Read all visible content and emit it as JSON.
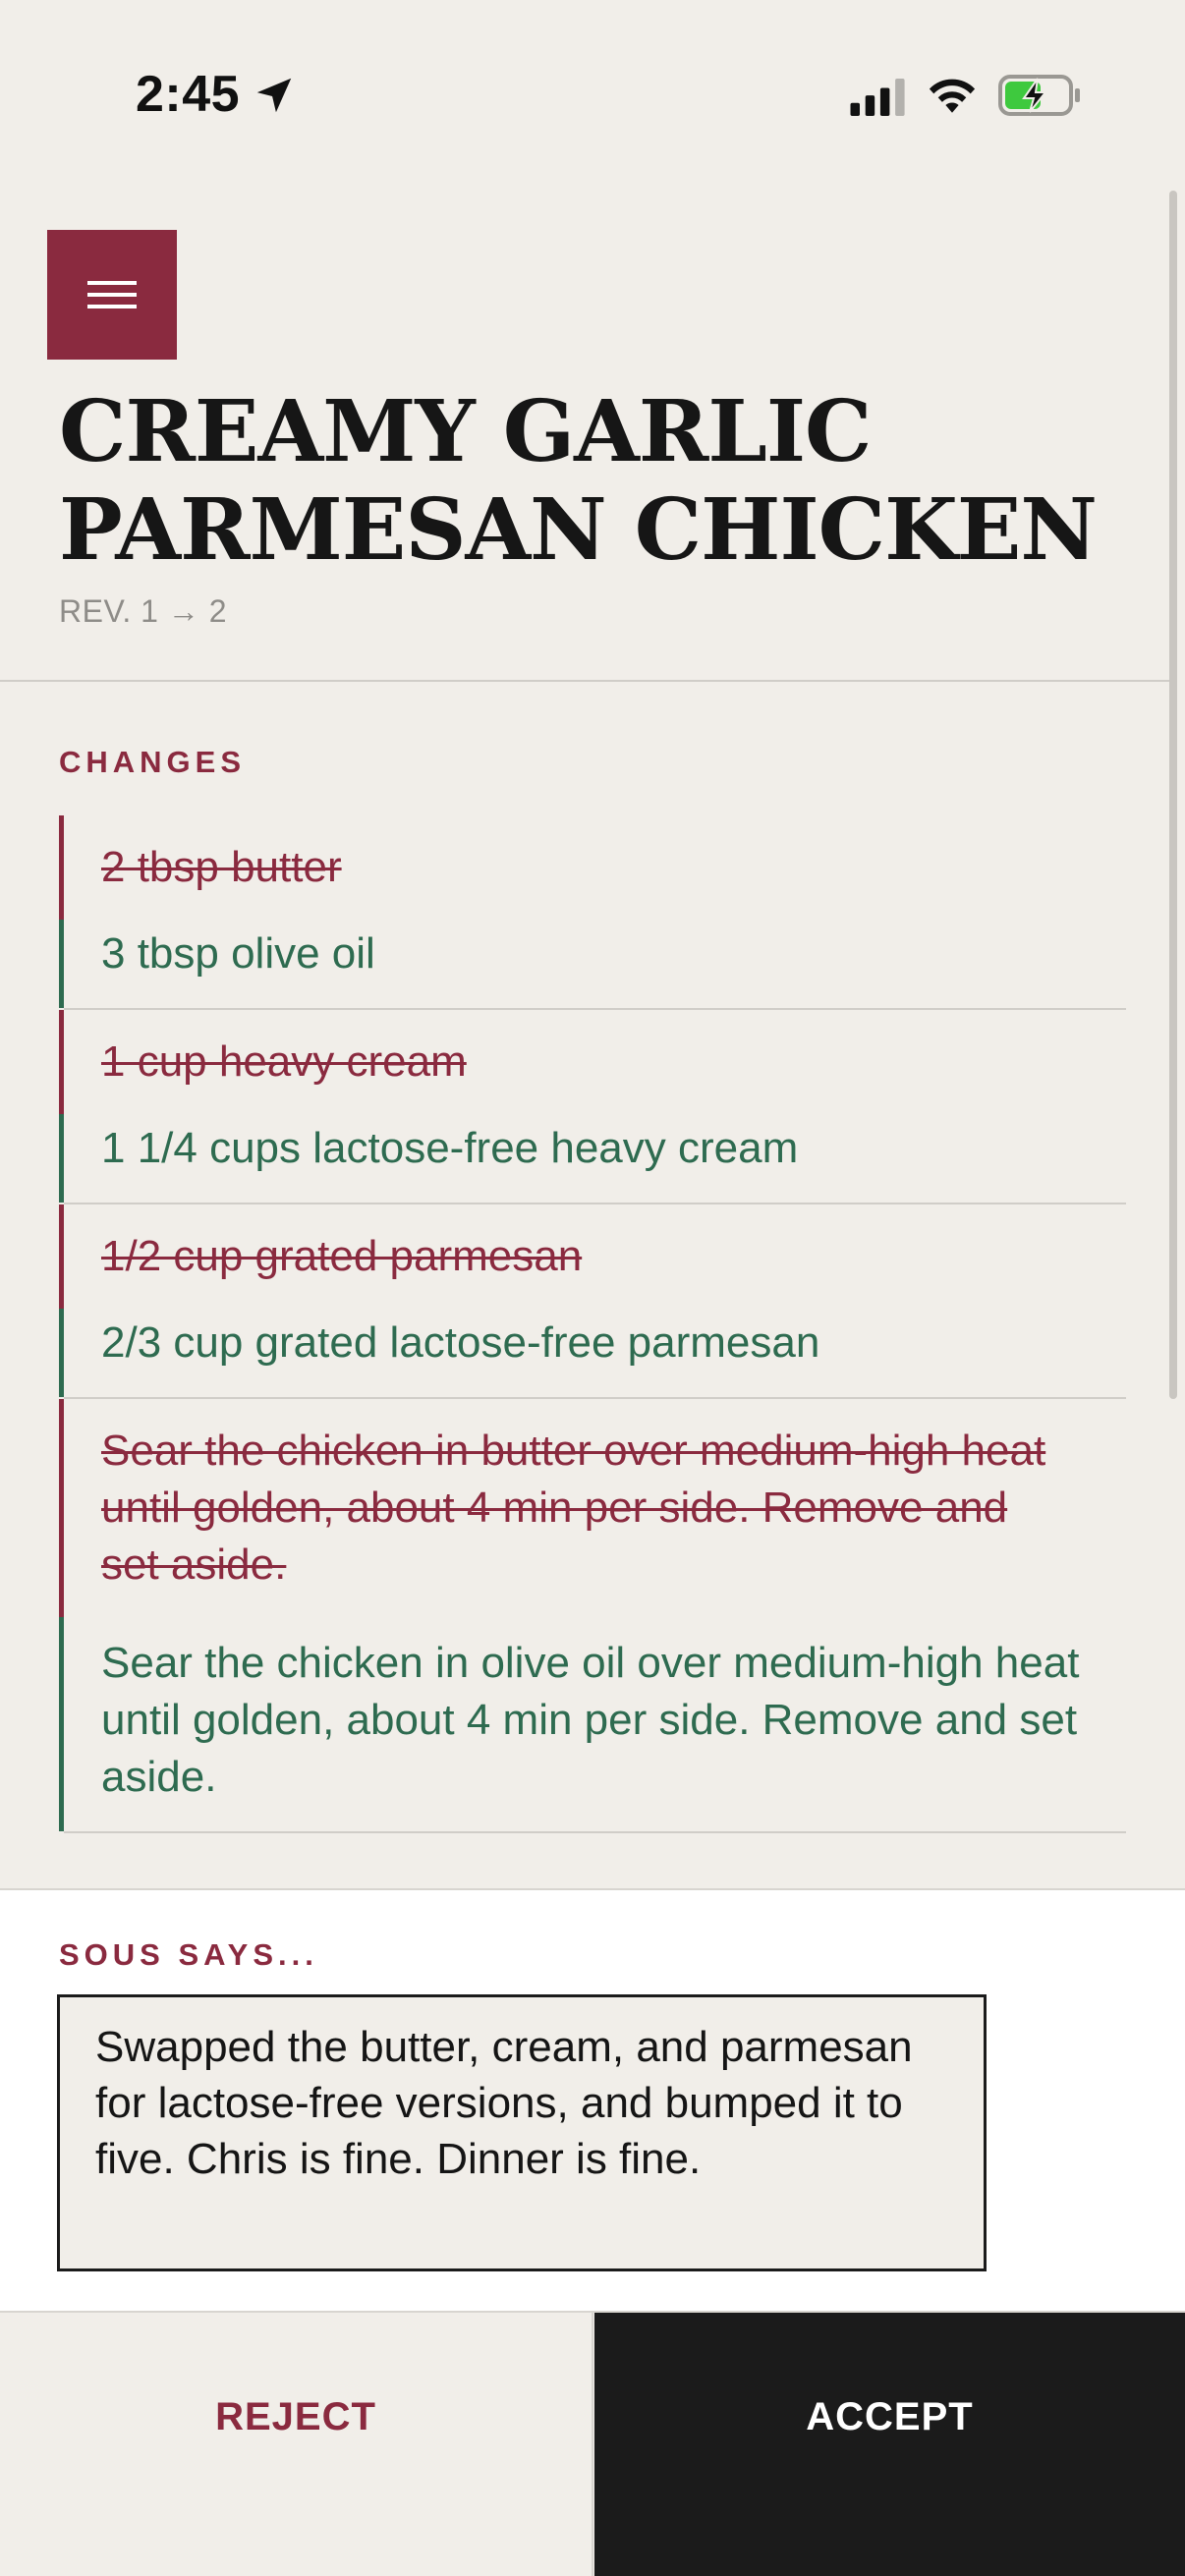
{
  "status_bar": {
    "time": "2:45",
    "location_icon": "location-arrow-icon",
    "signal_icon": "cellular-signal-icon",
    "wifi_icon": "wifi-icon",
    "battery_icon": "battery-charging-icon"
  },
  "header": {
    "menu_icon": "hamburger-menu-icon",
    "title_line1": "CREAMY GARLIC",
    "title_line2": "PARMESAN CHICKEN",
    "revision": "REV. 1 → 2"
  },
  "changes": {
    "label": "CHANGES",
    "items": [
      {
        "removed": "2 tbsp butter",
        "added": "3 tbsp olive oil"
      },
      {
        "removed": "1 cup heavy cream",
        "added": "1 1/4 cups lactose-free heavy cream"
      },
      {
        "removed": "1/2 cup grated parmesan",
        "added": "2/3 cup grated lactose-free parmesan"
      },
      {
        "removed": "Sear the chicken in butter over medium-high heat until golden, about 4 min per side. Remove and set aside.",
        "added": "Sear the chicken in olive oil over medium-high heat until golden, about 4 min per side. Remove and set aside."
      }
    ]
  },
  "sous": {
    "label": "SOUS SAYS...",
    "message": "Swapped the butter, cream, and parmesan for lactose-free versions, and bumped it to five. Chris is fine. Dinner is fine."
  },
  "actions": {
    "reject_label": "REJECT",
    "accept_label": "ACCEPT"
  },
  "colors": {
    "background": "#f1eee9",
    "accent_red": "#8a2a3f",
    "accent_green": "#2e6b50",
    "dark": "#1b1b1b"
  }
}
